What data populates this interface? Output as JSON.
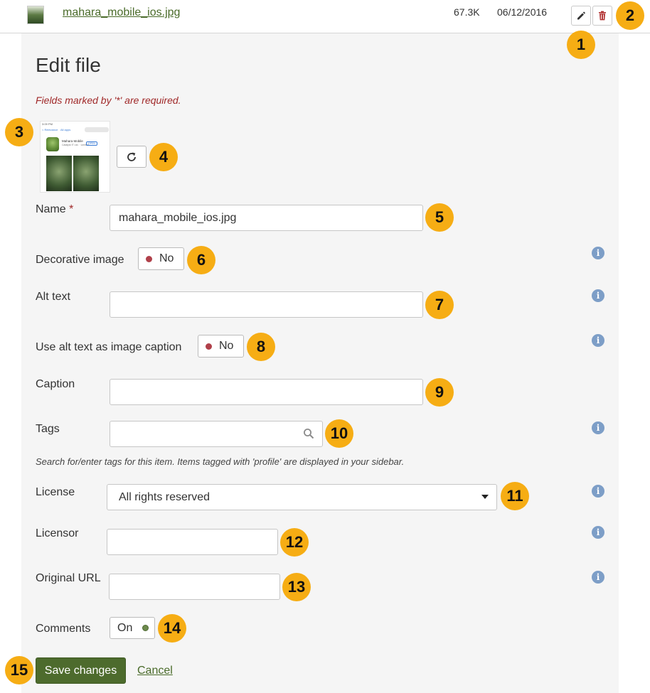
{
  "file_row": {
    "filename": "mahara_mobile_ios.jpg",
    "size": "67.3K",
    "date": "06/12/2016",
    "edit_icon": "pencil-icon",
    "delete_icon": "trash-icon"
  },
  "form": {
    "title": "Edit file",
    "required_note": "Fields marked by '*' are required.",
    "name_label": "Name",
    "required_star": "*",
    "name_value": "mahara_mobile_ios.jpg",
    "decorative_label": "Decorative image",
    "decorative_state": "No",
    "alt_label": "Alt text",
    "alt_value": "",
    "alt_caption_label": "Use alt text as image caption",
    "alt_caption_state": "No",
    "caption_label": "Caption",
    "caption_value": "",
    "tags_label": "Tags",
    "tags_value": "",
    "tags_hint": "Search for/enter tags for this item. Items tagged with 'profile' are displayed in your sidebar.",
    "license_label": "License",
    "license_value": "All rights reserved",
    "licensor_label": "Licensor",
    "licensor_value": "",
    "original_url_label": "Original URL",
    "original_url_value": "",
    "comments_label": "Comments",
    "comments_state": "On",
    "save_label": "Save changes",
    "cancel_label": "Cancel",
    "info_glyph": "i"
  },
  "preview": {
    "status_time": "3:09 PM",
    "nav_left": "< Relevance",
    "nav_mid": "All apps",
    "app_name": "Mahara Mobile",
    "app_sub": "Catalyst IT Ltd. · Limited",
    "open_label": "OPEN"
  },
  "badges": [
    "1",
    "2",
    "3",
    "4",
    "5",
    "6",
    "7",
    "8",
    "9",
    "10",
    "11",
    "12",
    "13",
    "14",
    "15"
  ],
  "colors": {
    "badge": "#f6ad14",
    "link": "#4a6b2a",
    "save": "#4d6b2d",
    "required": "#a02929",
    "info": "#7d9ec7",
    "panel": "#f5f5f5"
  }
}
